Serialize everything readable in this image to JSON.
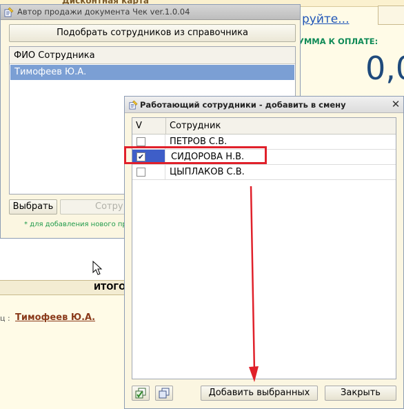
{
  "background": {
    "discount_card_label": "Дисконтная карта",
    "link_text": "руйте...",
    "sum_label": "УММА К ОПЛАТЕ:",
    "sum_value": "0,0",
    "total_label": "ИТОГО",
    "field_colon": "ц :",
    "seller_name": "Тимофеев Ю.А."
  },
  "author_window": {
    "title": "Автор продажи документа Чек ver.1.0.04",
    "pick_button": "Подобрать сотрудников  из справочника",
    "list_header": "ФИО Сотрудника",
    "rows": [
      "Тимофеев Ю.А."
    ],
    "choose_button": "Выбрать",
    "employee_button": "Сотру",
    "hint": "* для добавления нового пр"
  },
  "employee_dialog": {
    "title": "Работающий сотрудники - добавить в смену",
    "close_glyph": "✕",
    "columns": {
      "v": "V",
      "employee": "Сотрудник"
    },
    "rows": [
      {
        "name": "ПЕТРОВ С.В.",
        "checked": false
      },
      {
        "name": "СИДОРОВА Н.В.",
        "checked": true
      },
      {
        "name": "ЦЫПЛАКОВ С.В.",
        "checked": false
      }
    ],
    "add_selected_button": "Добавить выбранных",
    "close_button": "Закрыть",
    "check_glyph": "✔"
  },
  "icons": {
    "title_icon": "document-pencil-icon",
    "select_all": "check-all-icon",
    "copy": "copy-icon",
    "cursor": "mouse-cursor-icon",
    "annotation_arrow": "red-arrow-icon"
  },
  "colors": {
    "selection_blue": "#7b9fd4",
    "check_cell_blue": "#3e5ec8",
    "annotation_red": "#e0202a",
    "sum_label_green": "#0f8a57",
    "link_blue": "#1f55b7"
  }
}
